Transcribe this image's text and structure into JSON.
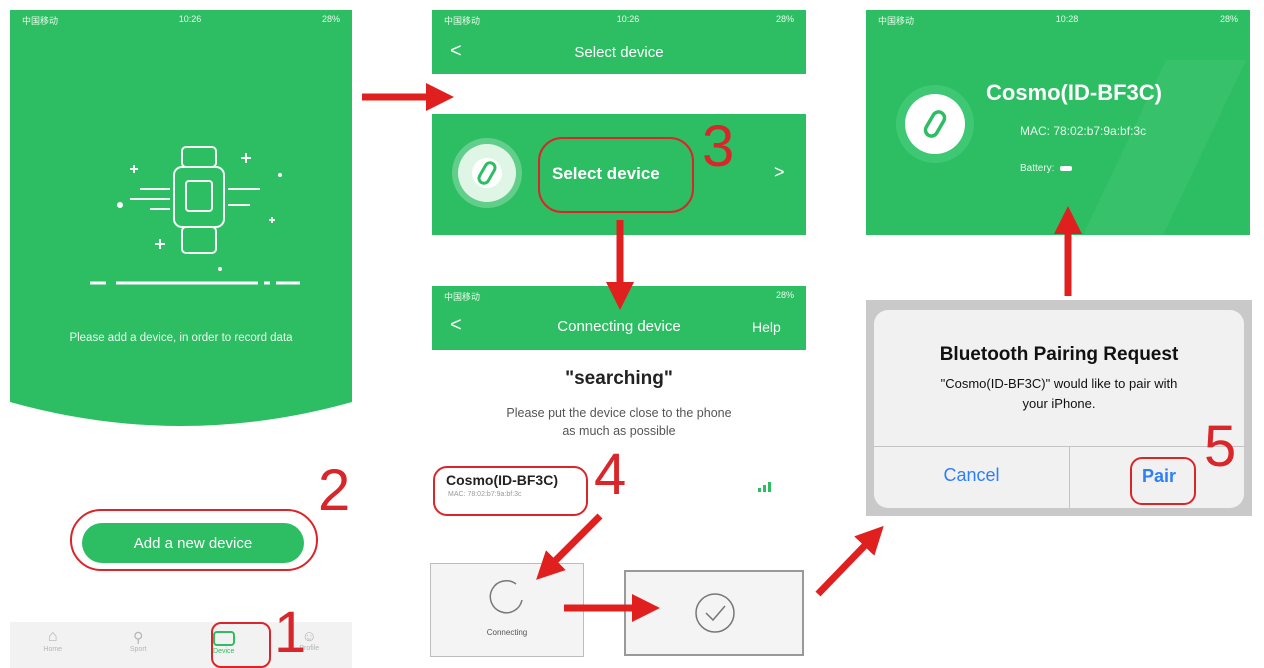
{
  "colors": {
    "green": "#2dbe63",
    "annotation_red": "#d8262a",
    "ios_blue": "#2d7ff9"
  },
  "panel1": {
    "status": {
      "carrier": "中国移动",
      "time": "10:26",
      "battery": "28%"
    },
    "illustration_icon": "smartwatch-icon",
    "message": "Please add a device, in order to record data",
    "add_button_label": "Add a new device",
    "tabs": [
      {
        "label": "Home",
        "icon": "home-icon"
      },
      {
        "label": "Sport",
        "icon": "run-icon"
      },
      {
        "label": "Device",
        "icon": "watch-icon"
      },
      {
        "label": "Profile",
        "icon": "person-icon"
      }
    ]
  },
  "panel2": {
    "status": {
      "carrier": "中国移动",
      "time": "10:26",
      "battery": "28%"
    },
    "title": "Select device",
    "back": "<",
    "card_label": "Select device",
    "chevron": ">"
  },
  "panel3": {
    "status": {
      "carrier": "中国移动",
      "battery": "28%"
    },
    "title": "Connecting device",
    "back": "<",
    "help": "Help",
    "heading": "\"searching\"",
    "instruction_line1": "Please put the device close to the phone",
    "instruction_line2": "as much as possible",
    "device_name": "Cosmo(ID-BF3C)",
    "device_mac": "MAC: 78:02:b7:9a:bf:3c"
  },
  "connecting_label": "Connecting",
  "panel5": {
    "status": {
      "carrier": "中国移动",
      "time": "10:28",
      "battery": "28%"
    },
    "device_name": "Cosmo(ID-BF3C)",
    "mac": "MAC: 78:02:b7:9a:bf:3c",
    "battery_label": "Battery:"
  },
  "dialog": {
    "title": "Bluetooth Pairing Request",
    "message_line1": "\"Cosmo(ID-BF3C)\" would like to pair with",
    "message_line2": "your iPhone.",
    "cancel": "Cancel",
    "pair": "Pair"
  },
  "annotations": [
    "1",
    "2",
    "3",
    "4",
    "5"
  ]
}
